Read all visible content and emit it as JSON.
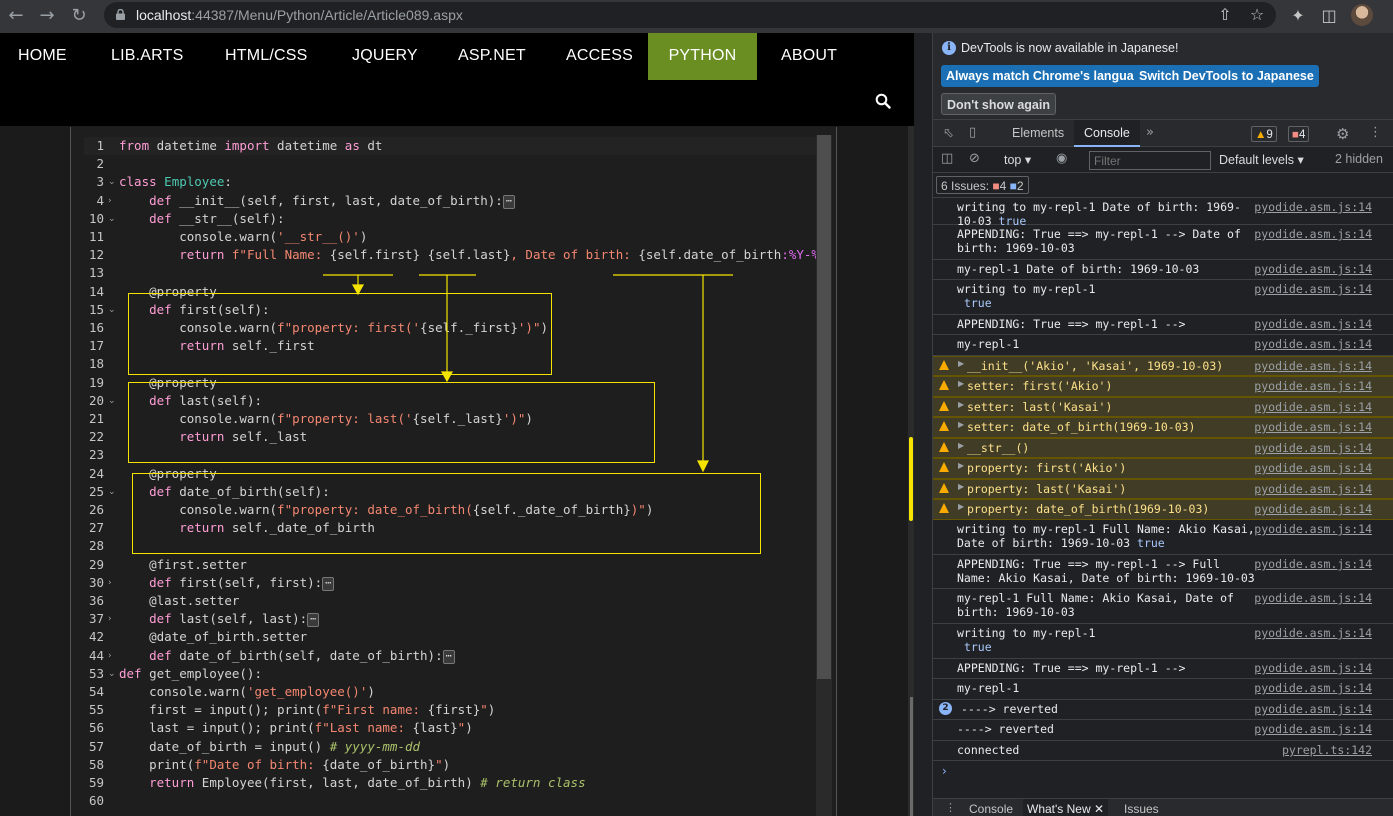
{
  "browser": {
    "url_host": "localhost",
    "url_rest": ":44387/Menu/Python/Article/Article089.aspx",
    "back_icon": "arrow-left-icon",
    "forward_icon": "arrow-right-icon",
    "reload_icon": "reload-icon"
  },
  "nav": {
    "items": [
      "HOME",
      "LIB.ARTS",
      "HTML/CSS",
      "JQUERY",
      "ASP.NET",
      "ACCESS",
      "PYTHON",
      "ABOUT"
    ],
    "active": "PYTHON",
    "active_color": "#6b8e23"
  },
  "code": [
    {
      "n": "1",
      "fold": "",
      "html": "<span class='kw'>from</span> datetime <span class='kw'>import</span> datetime <span class='kw'>as</span> dt"
    },
    {
      "n": "2",
      "fold": "",
      "html": ""
    },
    {
      "n": "3",
      "fold": "v",
      "html": "<span class='kw'>class</span> <span class='cls'>Employee</span>:"
    },
    {
      "n": "4",
      "fold": ">",
      "html": "    <span class='kw'>def</span> __init__(self, first, last, date_of_birth):<span class='ellipsis'>⋯</span>"
    },
    {
      "n": "10",
      "fold": "v",
      "html": "    <span class='kw'>def</span> __str__(self):"
    },
    {
      "n": "11",
      "fold": "",
      "html": "        console.warn(<span class='str'>'__str__()'</span>)"
    },
    {
      "n": "12",
      "fold": "",
      "html": "        <span class='kw'>return</span> <span class='str'>f\"Full Name: </span>{self.first} {self.last}<span class='str'>, Date of birth: </span>{self.date_of_birth<span class='fmt'>:%Y-%m-%d</span>}"
    },
    {
      "n": "13",
      "fold": "",
      "html": ""
    },
    {
      "n": "14",
      "fold": "",
      "html": "    @property"
    },
    {
      "n": "15",
      "fold": "v",
      "html": "    <span class='kw'>def</span> first(self):"
    },
    {
      "n": "16",
      "fold": "",
      "html": "        console.warn(<span class='str'>f\"property: first('</span>{self._first}<span class='str'>')\"</span>)"
    },
    {
      "n": "17",
      "fold": "",
      "html": "        <span class='kw'>return</span> self._first"
    },
    {
      "n": "18",
      "fold": "",
      "html": ""
    },
    {
      "n": "19",
      "fold": "",
      "html": "    @property"
    },
    {
      "n": "20",
      "fold": "v",
      "html": "    <span class='kw'>def</span> last(self):"
    },
    {
      "n": "21",
      "fold": "",
      "html": "        console.warn(<span class='str'>f\"property: last('</span>{self._last}<span class='str'>')\"</span>)"
    },
    {
      "n": "22",
      "fold": "",
      "html": "        <span class='kw'>return</span> self._last"
    },
    {
      "n": "23",
      "fold": "",
      "html": ""
    },
    {
      "n": "24",
      "fold": "",
      "html": "    @property"
    },
    {
      "n": "25",
      "fold": "v",
      "html": "    <span class='kw'>def</span> date_of_birth(self):"
    },
    {
      "n": "26",
      "fold": "",
      "html": "        console.warn(<span class='str'>f\"property: date_of_birth(</span>{self._date_of_birth}<span class='str'>)\"</span>)"
    },
    {
      "n": "27",
      "fold": "",
      "html": "        <span class='kw'>return</span> self._date_of_birth"
    },
    {
      "n": "28",
      "fold": "",
      "html": ""
    },
    {
      "n": "29",
      "fold": "",
      "html": "    @first.setter"
    },
    {
      "n": "30",
      "fold": ">",
      "html": "    <span class='kw'>def</span> first(self, first):<span class='ellipsis'>⋯</span>"
    },
    {
      "n": "36",
      "fold": "",
      "html": "    @last.setter"
    },
    {
      "n": "37",
      "fold": ">",
      "html": "    <span class='kw'>def</span> last(self, last):<span class='ellipsis'>⋯</span>"
    },
    {
      "n": "42",
      "fold": "",
      "html": "    @date_of_birth.setter"
    },
    {
      "n": "44",
      "fold": ">",
      "html": "    <span class='kw'>def</span> date_of_birth(self, date_of_birth):<span class='ellipsis'>⋯</span>"
    },
    {
      "n": "53",
      "fold": "v",
      "html": "<span class='kw'>def</span> get_employee():"
    },
    {
      "n": "54",
      "fold": "",
      "html": "    console.warn(<span class='str'>'get_employee()'</span>)"
    },
    {
      "n": "55",
      "fold": "",
      "html": "    first = input(); print(<span class='str'>f\"First name: </span>{first}<span class='str'>\"</span>)"
    },
    {
      "n": "56",
      "fold": "",
      "html": "    last = input(); print(<span class='str'>f\"Last name: </span>{last}<span class='str'>\"</span>)"
    },
    {
      "n": "57",
      "fold": "",
      "html": "    date_of_birth = input() <span class='cmt'># yyyy-mm-dd</span>"
    },
    {
      "n": "58",
      "fold": "",
      "html": "    print(<span class='str'>f\"Date of birth: </span>{date_of_birth}<span class='str'>\"</span>)"
    },
    {
      "n": "59",
      "fold": "",
      "html": "    <span class='kw'>return</span> Employee(first, last, date_of_birth) <span class='cmt'># return class</span>"
    },
    {
      "n": "60",
      "fold": "",
      "html": ""
    }
  ],
  "devtools": {
    "info_text": "DevTools is now available in Japanese!",
    "btn_match": "Always match Chrome's language",
    "btn_switch": "Switch DevTools to Japanese",
    "btn_dont_show": "Don't show again",
    "tab_elements": "Elements",
    "tab_console": "Console",
    "warn_count": "9",
    "error_count": "4",
    "context": "top",
    "filter_placeholder": "Filter",
    "levels": "Default levels",
    "hidden": "2 hidden",
    "issues_label": "6 Issues:",
    "issues_errors": "4",
    "issues_info": "2",
    "drawer_console": "Console",
    "drawer_whats_new": "What's New",
    "drawer_issues": "Issues"
  },
  "console": [
    {
      "type": "log",
      "msg": "writing to my-repl-1 Date of birth: 1969-10-03",
      "bool": " true",
      "src": "pyodide.asm.js:14",
      "h": 27
    },
    {
      "type": "log",
      "msg": "APPENDING: True ==> my-repl-1 --> Date of birth: 1969-10-03",
      "bool": "",
      "src": "pyodide.asm.js:14",
      "h": 35
    },
    {
      "type": "log",
      "msg": "my-repl-1 Date of birth: 1969-10-03",
      "bool": "",
      "src": "pyodide.asm.js:14",
      "h": 20
    },
    {
      "type": "log",
      "msg": "writing to my-repl-1\n",
      "bool": " true",
      "src": "pyodide.asm.js:14",
      "h": 35
    },
    {
      "type": "log",
      "msg": "APPENDING: True ==> my-repl-1 -->",
      "bool": "",
      "src": "pyodide.asm.js:14",
      "h": 20
    },
    {
      "type": "log",
      "msg": "my-repl-1",
      "bool": "",
      "src": "pyodide.asm.js:14",
      "h": 21
    },
    {
      "type": "warn",
      "msg": "__init__('Akio', 'Kasai', 1969-10-03)",
      "bool": "",
      "src": "pyodide.asm.js:14",
      "h": 20
    },
    {
      "type": "warn",
      "msg": "setter: first('Akio')",
      "bool": "",
      "src": "pyodide.asm.js:14",
      "h": 21
    },
    {
      "type": "warn",
      "msg": "setter: last('Kasai')",
      "bool": "",
      "src": "pyodide.asm.js:14",
      "h": 20
    },
    {
      "type": "warn",
      "msg": "setter: date_of_birth(1969-10-03)",
      "bool": "",
      "src": "pyodide.asm.js:14",
      "h": 21
    },
    {
      "type": "warn",
      "msg": "__str__()",
      "bool": "",
      "src": "pyodide.asm.js:14",
      "h": 20
    },
    {
      "type": "warn",
      "msg": "property: first('Akio')",
      "bool": "",
      "src": "pyodide.asm.js:14",
      "h": 21
    },
    {
      "type": "warn",
      "msg": "property: last('Kasai')",
      "bool": "",
      "src": "pyodide.asm.js:14",
      "h": 20
    },
    {
      "type": "warn",
      "msg": "property: date_of_birth(1969-10-03)",
      "bool": "",
      "src": "pyodide.asm.js:14",
      "h": 21
    },
    {
      "type": "log",
      "msg": "writing to my-repl-1 Full Name: Akio Kasai, Date of birth: 1969-10-03",
      "bool": " true",
      "src": "pyodide.asm.js:14",
      "h": 35
    },
    {
      "type": "log",
      "msg": "APPENDING: True ==> my-repl-1 --> Full Name: Akio Kasai, Date of birth: 1969-10-03",
      "bool": "",
      "src": "pyodide.asm.js:14",
      "h": 34
    },
    {
      "type": "log",
      "msg": "my-repl-1 Full Name: Akio Kasai, Date of birth: 1969-10-03",
      "bool": "",
      "src": "pyodide.asm.js:14",
      "h": 35
    },
    {
      "type": "log",
      "msg": "writing to my-repl-1\n",
      "bool": " true",
      "src": "pyodide.asm.js:14",
      "h": 35
    },
    {
      "type": "log",
      "msg": "APPENDING: True ==> my-repl-1 -->",
      "bool": "",
      "src": "pyodide.asm.js:14",
      "h": 20
    },
    {
      "type": "log",
      "msg": "my-repl-1",
      "bool": "",
      "src": "pyodide.asm.js:14",
      "h": 21
    },
    {
      "type": "count",
      "count": "2",
      "msg": "----> reverted",
      "bool": "",
      "src": "pyodide.asm.js:14",
      "h": 20
    },
    {
      "type": "log",
      "msg": "----> reverted",
      "bool": "",
      "src": "pyodide.asm.js:14",
      "h": 21
    },
    {
      "type": "log",
      "msg": "connected",
      "bool": "",
      "src": "pyrepl.ts:142",
      "h": 20
    }
  ],
  "colors": {
    "highlight": "#f5e400",
    "warn_bg": "#413c26",
    "devtools_blue": "#1a6fb5"
  }
}
